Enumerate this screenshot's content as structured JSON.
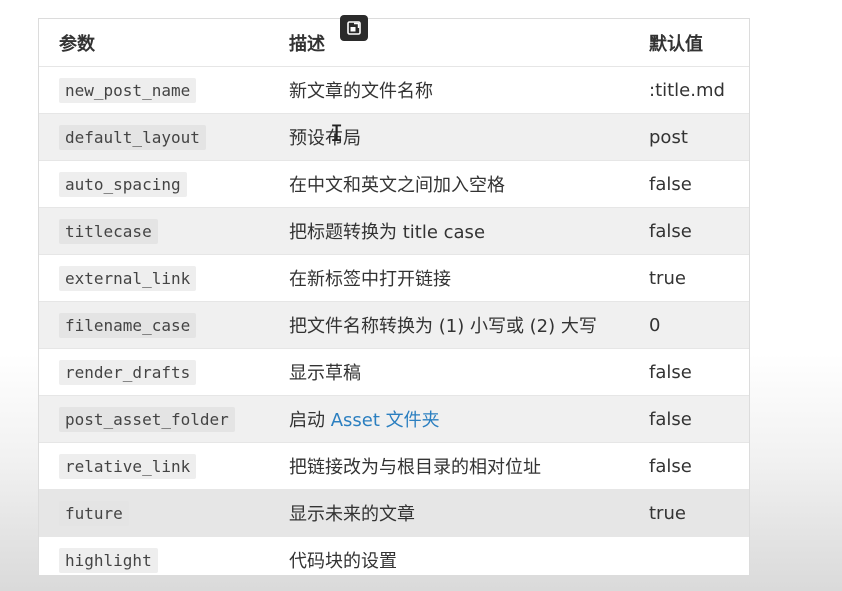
{
  "table": {
    "headers": [
      "参数",
      "描述",
      "默认值"
    ],
    "rows": [
      {
        "param": "new_post_name",
        "desc": "新文章的文件名称",
        "default": ":title.md"
      },
      {
        "param": "default_layout",
        "desc": "预设布局",
        "default": "post"
      },
      {
        "param": "auto_spacing",
        "desc": "在中文和英文之间加入空格",
        "default": "false"
      },
      {
        "param": "titlecase",
        "desc": "把标题转换为 title case",
        "default": "false"
      },
      {
        "param": "external_link",
        "desc": "在新标签中打开链接",
        "default": "true"
      },
      {
        "param": "filename_case",
        "desc": "把文件名称转换为 (1) 小写或 (2) 大写",
        "default": "0"
      },
      {
        "param": "render_drafts",
        "desc": "显示草稿",
        "default": "false"
      },
      {
        "param": "post_asset_folder",
        "desc_prefix": "启动 ",
        "desc_link": "Asset 文件夹",
        "default": "false"
      },
      {
        "param": "relative_link",
        "desc": "把链接改为与根目录的相对位址",
        "default": "false"
      },
      {
        "param": "future",
        "desc": "显示未来的文章",
        "default": "true"
      },
      {
        "param": "highlight",
        "desc": "代码块的设置",
        "default": ""
      }
    ]
  },
  "icons": {
    "popout": "popout-icon",
    "cursor": "text-cursor-icon"
  },
  "colors": {
    "link": "#2b7fc0",
    "stripe": "#f0f0f0",
    "hover_row": "#e6e6e6",
    "border": "#dcdcdc"
  }
}
